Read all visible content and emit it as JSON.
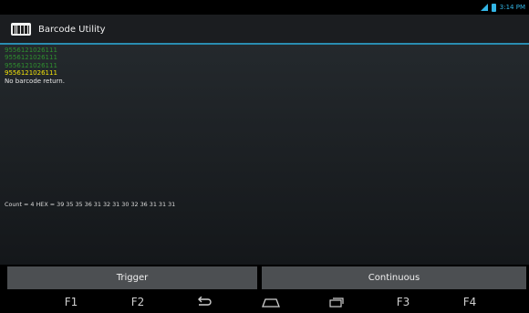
{
  "status_bar": {
    "time": "3:14 PM",
    "icons": [
      "signal-icon",
      "battery-icon"
    ]
  },
  "app": {
    "title": "Barcode Utility",
    "icon": "barcode-app-icon",
    "accent_color": "#33b5e5"
  },
  "log": {
    "previous_reads": [
      "9556121026111",
      "9556121026111",
      "9556121026111"
    ],
    "current_read": "9556121026111",
    "message": "No barcode return.",
    "colors": {
      "previous": "#2f8f2f",
      "current": "#f2e20a"
    }
  },
  "hex_line": "Count = 4 HEX = 39 35 35 36 31 32 31 30 32 36 31 31 31",
  "buttons": {
    "trigger": "Trigger",
    "continuous": "Continuous"
  },
  "nav": {
    "f1": "F1",
    "f2": "F2",
    "f3": "F3",
    "f4": "F4",
    "icons": [
      "back-icon",
      "home-icon",
      "recent-apps-icon"
    ]
  }
}
